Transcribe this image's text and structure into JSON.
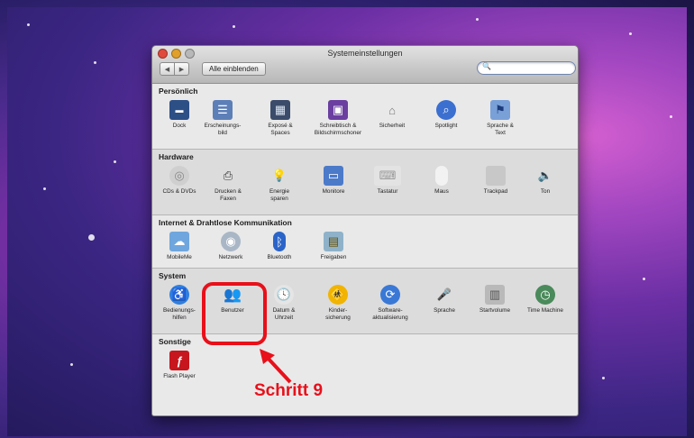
{
  "window": {
    "title": "Systemeinstellungen"
  },
  "toolbar": {
    "back": "◀",
    "forward": "▶",
    "show_all": "Alle einblenden",
    "search_placeholder": ""
  },
  "sections": [
    {
      "title": "Persönlich",
      "items": [
        {
          "label": "Dock",
          "icon": "dock-icon"
        },
        {
          "label": "Erscheinungs-\nbild",
          "icon": "appearance-icon"
        },
        {
          "label": "Exposé &\nSpaces",
          "icon": "expose-icon"
        },
        {
          "label": "Schreibtisch &\nBildschirmschoner",
          "icon": "desktop-icon"
        },
        {
          "label": "Sicherheit",
          "icon": "security-icon"
        },
        {
          "label": "Spotlight",
          "icon": "spotlight-icon"
        },
        {
          "label": "Sprache &\nText",
          "icon": "language-icon"
        }
      ]
    },
    {
      "title": "Hardware",
      "items": [
        {
          "label": "CDs & DVDs",
          "icon": "cd-icon"
        },
        {
          "label": "Drucken &\nFaxen",
          "icon": "printer-icon"
        },
        {
          "label": "Energie\nsparen",
          "icon": "energy-icon"
        },
        {
          "label": "Monitore",
          "icon": "monitor-icon"
        },
        {
          "label": "Tastatur",
          "icon": "keyboard-icon"
        },
        {
          "label": "Maus",
          "icon": "mouse-icon"
        },
        {
          "label": "Trackpad",
          "icon": "trackpad-icon"
        },
        {
          "label": "Ton",
          "icon": "sound-icon"
        }
      ]
    },
    {
      "title": "Internet & Drahtlose Kommunikation",
      "items": [
        {
          "label": "MobileMe",
          "icon": "mobileme-icon"
        },
        {
          "label": "Netzwerk",
          "icon": "network-icon"
        },
        {
          "label": "Bluetooth",
          "icon": "bluetooth-icon"
        },
        {
          "label": "Freigaben",
          "icon": "sharing-icon"
        }
      ]
    },
    {
      "title": "System",
      "items": [
        {
          "label": "Bedienungs-\nhilfen",
          "icon": "accessibility-icon"
        },
        {
          "label": "Benutzer",
          "icon": "users-icon"
        },
        {
          "label": "Datum &\nUhrzeit",
          "icon": "clock-icon"
        },
        {
          "label": "Kinder-\nsicherung",
          "icon": "parental-controls-icon"
        },
        {
          "label": "Software-\naktualisierung",
          "icon": "software-update-icon"
        },
        {
          "label": "Sprache",
          "icon": "speech-icon"
        },
        {
          "label": "Startvolume",
          "icon": "startup-disk-icon"
        },
        {
          "label": "Time Machine",
          "icon": "time-machine-icon"
        }
      ]
    },
    {
      "title": "Sonstige",
      "items": [
        {
          "label": "Flash Player",
          "icon": "flash-icon"
        }
      ]
    }
  ],
  "annotation": {
    "text": "Schritt 9",
    "color": "#e8101a"
  }
}
